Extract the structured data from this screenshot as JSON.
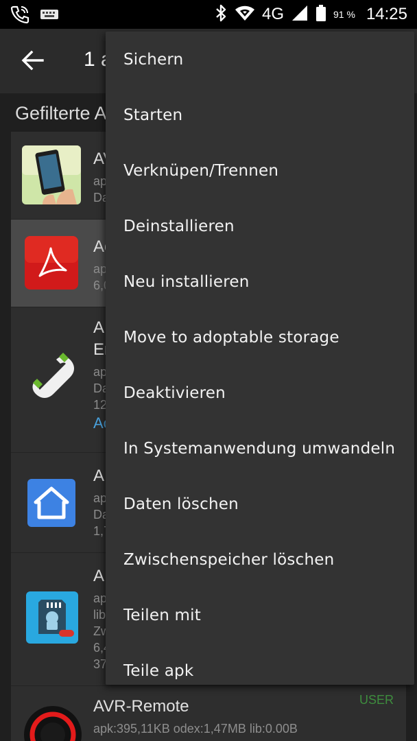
{
  "status_bar": {
    "network": "4G",
    "battery_percent": "91 %",
    "time": "14:25",
    "icons": [
      "phone-call-icon",
      "keyboard-icon",
      "bluetooth-icon",
      "wifi-icon",
      "signal-icon",
      "battery-icon"
    ]
  },
  "toolbar": {
    "back_icon": "arrow-left-icon",
    "title": "1 a"
  },
  "filter_label": "Gefilterte A",
  "apps": [
    {
      "name": "AV",
      "lines": [
        "ap",
        "Da"
      ],
      "icon": "phone-in-hand-icon"
    },
    {
      "name": "Ac",
      "lines": [
        "ap",
        "6,0"
      ],
      "icon": "acrobat-icon",
      "selected": true
    },
    {
      "name": "A",
      "lines": [
        "Er",
        "ap",
        "Da",
        "12"
      ],
      "link": "Ac",
      "icon": "phone-handset-icon"
    },
    {
      "name": "A",
      "lines": [
        "ap",
        "Da",
        "1,7"
      ],
      "icon": "home-icon"
    },
    {
      "name": "A",
      "lines": [
        "ap",
        "lib",
        "Zw",
        "6,4",
        "37"
      ],
      "icon": "sd-android-pro-icon"
    },
    {
      "name": "AVR-Remote",
      "lines": [
        "apk:395,11KB odex:1,47MB lib:0.00B"
      ],
      "badge": "USER",
      "icon": "red-ring-icon"
    }
  ],
  "menu": {
    "items": [
      "Sichern",
      "Starten",
      "Verknüpen/Trennen",
      "Deinstallieren",
      "Neu installieren",
      "Move to adoptable storage",
      "Deaktivieren",
      "In Systemanwendung umwandeln",
      "Daten löschen",
      "Zwischenspeicher löschen",
      "Teilen mit",
      "Teile apk"
    ]
  },
  "colors": {
    "status_bar": "#000000",
    "toolbar": "#2b2b2b",
    "menu_background": "#333333",
    "row_background": "#2e2e2e",
    "row_selected": "#4a4a4a",
    "link": "#4aa3df",
    "badge_user": "#3e8d3e"
  }
}
